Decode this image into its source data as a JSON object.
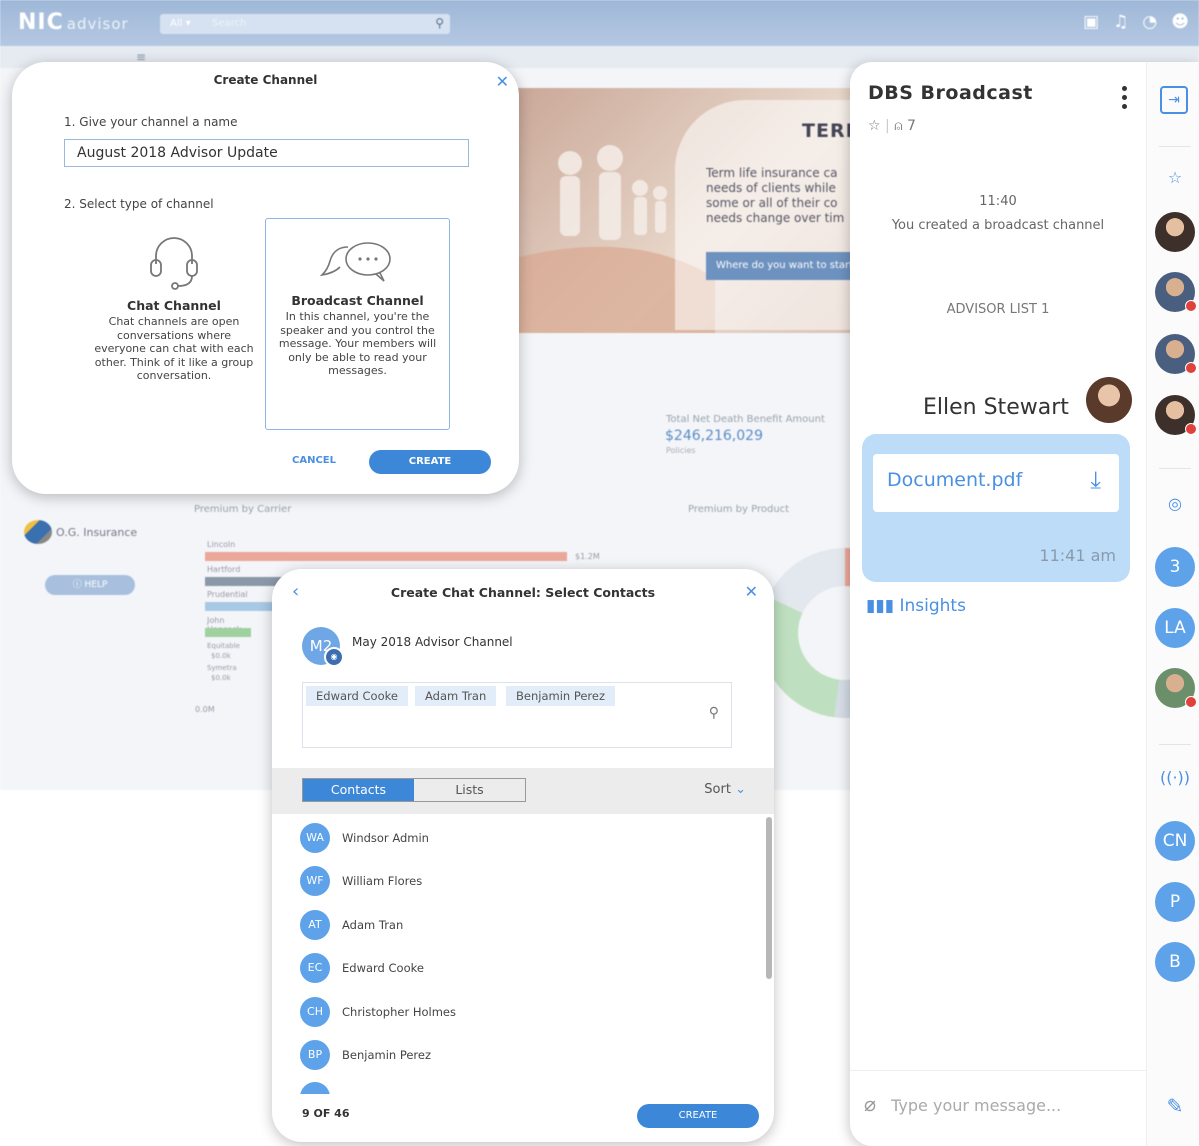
{
  "background_app": {
    "logo": "NIC",
    "logo_sub": "advisor",
    "search_scope": "All",
    "search_placeholder": "Search",
    "hero_title": "TERM",
    "hero_text_lines": [
      "Term life insurance ca",
      "needs of clients while",
      "some or all of their co",
      "needs change over tim"
    ],
    "hero_button": "Where do you want to start",
    "stat_label": "Total Net Death Benefit Amount",
    "stat_value": "$246,216,029",
    "stat_sub": "Policies",
    "carrier_chart_title": "Premium by Carrier",
    "product_chart_title": "Premium by Product",
    "agency_name": "O.G. Insurance",
    "help_label": "HELP",
    "carrier_labels": [
      "Lincoln",
      "Hartford",
      "Prudential",
      "John Hancock",
      "Equitable",
      "Symetra"
    ],
    "carrier_value_top": "$1.2M",
    "equitable_value": "$0.0k",
    "symetra_value": "$0.0k",
    "axis_start": "0.0M"
  },
  "create_channel": {
    "title": "Create Channel",
    "step1_label": "1. Give your channel a name",
    "channel_name_value": "August 2018 Advisor Update",
    "step2_label": "2. Select type of channel",
    "chat_title": "Chat Channel",
    "chat_desc": "Chat channels are open conversations where everyone can chat with each other. Think of it like a group conversation.",
    "broadcast_title": "Broadcast Channel",
    "broadcast_desc": "In this channel, you're the speaker and you control the message. Your members will only be able to read your messages.",
    "cancel_label": "CANCEL",
    "create_label": "CREATE"
  },
  "select_contacts": {
    "title": "Create Chat Channel: Select Contacts",
    "channel_initials": "M2",
    "channel_name": "May 2018 Advisor Channel",
    "selected_tags": [
      "Edward Cooke",
      "Adam Tran",
      "Benjamin Perez"
    ],
    "tab_contacts": "Contacts",
    "tab_lists": "Lists",
    "sort_label": "Sort",
    "contacts": [
      {
        "initials": "WA",
        "name": "Windsor Admin"
      },
      {
        "initials": "WF",
        "name": "William Flores"
      },
      {
        "initials": "AT",
        "name": "Adam Tran"
      },
      {
        "initials": "EC",
        "name": "Edward Cooke"
      },
      {
        "initials": "CH",
        "name": "Christopher Holmes"
      },
      {
        "initials": "BP",
        "name": "Benjamin Perez"
      }
    ],
    "count_label": "9 OF 46",
    "create_label": "CREATE"
  },
  "broadcast_panel": {
    "title": "DBS Broadcast",
    "member_count": "7",
    "time_created": "11:40",
    "created_message": "You created a broadcast channel",
    "list_label": "ADVISOR LIST 1",
    "sender_name": "Ellen Stewart",
    "attachment_name": "Document.pdf",
    "message_time": "11:41 am",
    "insights_label": "Insights",
    "input_placeholder": "Type your message...",
    "rail_initials": [
      "3",
      "LA",
      "CN",
      "P",
      "B"
    ]
  },
  "colors": {
    "accent": "#4a90e2",
    "button_blue": "#3d87d8",
    "bubble": "#bcdcf8",
    "notification_red": "#e0413b"
  }
}
